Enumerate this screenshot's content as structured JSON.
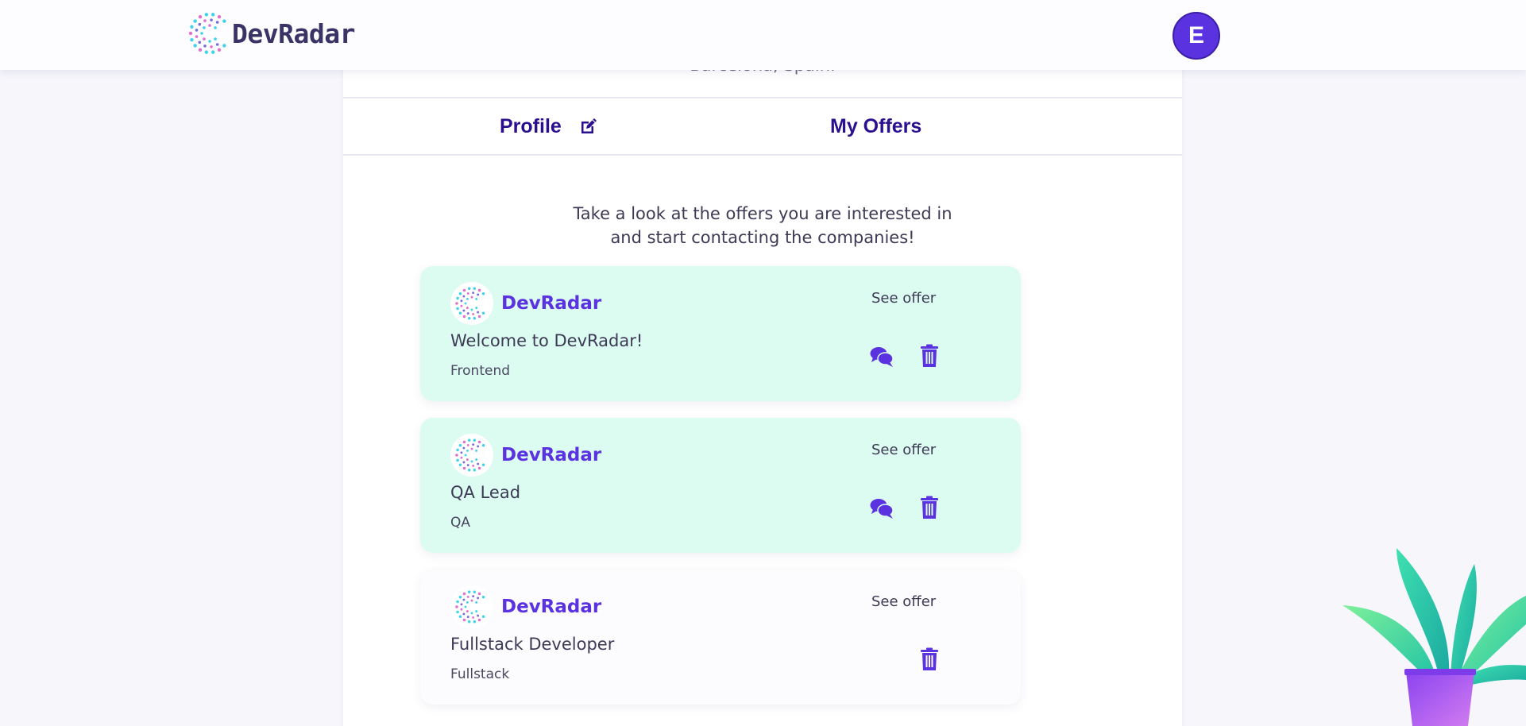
{
  "header": {
    "logo_text": "DevRadar",
    "avatar_initial": "E"
  },
  "profile": {
    "location": "Barcelona, Spain."
  },
  "tabs": [
    {
      "label": "Profile",
      "icon": "edit-icon"
    },
    {
      "label": "My Offers"
    }
  ],
  "intro": {
    "line1": "Take a look at the offers you are interested in",
    "line2": "and start contacting the companies!"
  },
  "offers": [
    {
      "company": "DevRadar",
      "title": "Welcome to DevRadar!",
      "category": "Frontend",
      "see_offer": "See offer",
      "highlighted": true,
      "has_chat": true
    },
    {
      "company": "DevRadar",
      "title": "QA Lead",
      "category": "QA",
      "see_offer": "See offer",
      "highlighted": true,
      "has_chat": true
    },
    {
      "company": "DevRadar",
      "title": "Fullstack Developer",
      "category": "Fullstack",
      "see_offer": "See offer",
      "highlighted": false,
      "has_chat": false
    }
  ],
  "colors": {
    "brand": "#5b32e0",
    "tab_text": "#2a0f8f",
    "highlight_card": "#dcfcf2",
    "background": "#f6f6fb"
  }
}
